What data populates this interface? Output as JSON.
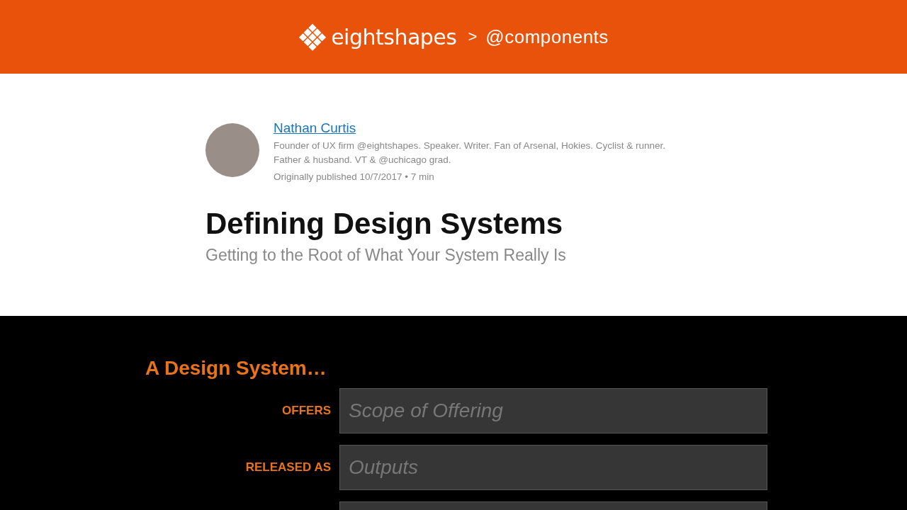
{
  "header": {
    "brand": "eightshapes",
    "separator": ">",
    "section": "@components"
  },
  "author": {
    "name": "Nathan Curtis",
    "bio": "Founder of UX firm @eightshapes. Speaker. Writer. Fan of Arsenal, Hokies. Cyclist & runner. Father & husband. VT & @uchicago grad.",
    "meta": "Originally published 10/7/2017 • 7 min"
  },
  "article": {
    "title": "Defining Design Systems",
    "subtitle": "Getting to the Root of What Your System Really Is"
  },
  "diagram": {
    "heading": "A Design System…",
    "rows": [
      {
        "kind": "labeled",
        "label": "OFFERS",
        "text": "Scope of Offering"
      },
      {
        "kind": "labeled",
        "label": "RELEASED AS",
        "text": "Outputs"
      },
      {
        "kind": "blank"
      }
    ]
  }
}
